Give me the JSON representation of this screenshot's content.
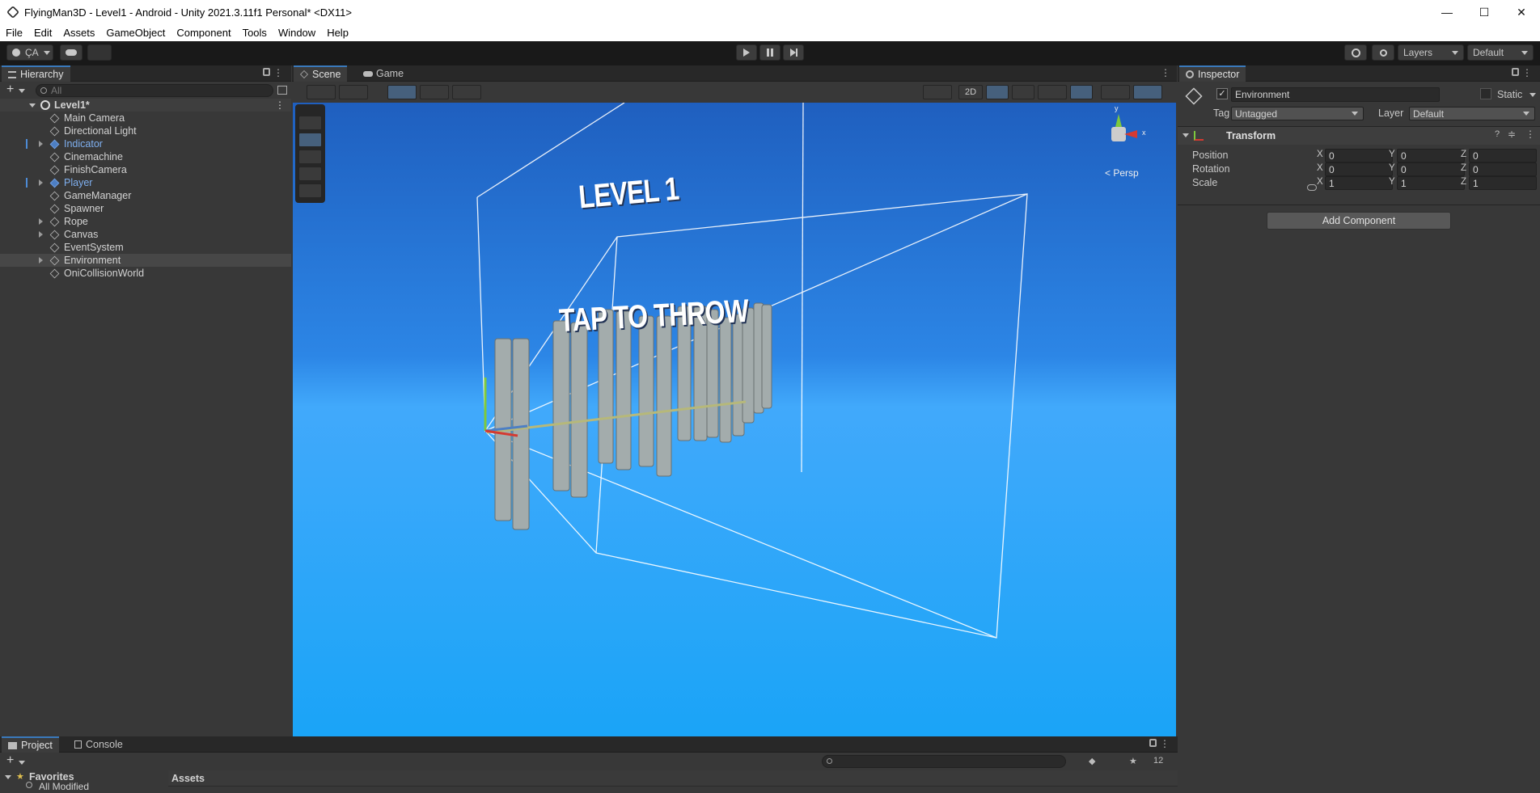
{
  "window": {
    "title": "FlyingMan3D - Level1 - Android - Unity 2021.3.11f1 Personal* <DX11>",
    "controls": {
      "minimize": "—",
      "maximize": "☐",
      "close": "✕"
    }
  },
  "menu": [
    "File",
    "Edit",
    "Assets",
    "GameObject",
    "Component",
    "Tools",
    "Window",
    "Help"
  ],
  "toolbar": {
    "account_label": "ÇA",
    "layers_label": "Layers",
    "layout_label": "Default"
  },
  "hierarchy": {
    "tab_label": "Hierarchy",
    "search_placeholder": "All",
    "scene_name": "Level1*",
    "items": [
      {
        "label": "Main Camera",
        "prefab": false,
        "expandable": false
      },
      {
        "label": "Directional Light",
        "prefab": false,
        "expandable": false
      },
      {
        "label": "Indicator",
        "prefab": true,
        "expandable": true
      },
      {
        "label": "Cinemachine",
        "prefab": false,
        "expandable": false
      },
      {
        "label": "FinishCamera",
        "prefab": false,
        "expandable": false
      },
      {
        "label": "Player",
        "prefab": true,
        "expandable": true
      },
      {
        "label": "GameManager",
        "prefab": false,
        "expandable": false
      },
      {
        "label": "Spawner",
        "prefab": false,
        "expandable": false
      },
      {
        "label": "Rope",
        "prefab": false,
        "expandable": true
      },
      {
        "label": "Canvas",
        "prefab": false,
        "expandable": true
      },
      {
        "label": "EventSystem",
        "prefab": false,
        "expandable": false
      },
      {
        "label": "Environment",
        "prefab": false,
        "expandable": true,
        "selected": true
      },
      {
        "label": "OniCollisionWorld",
        "prefab": false,
        "expandable": false
      }
    ]
  },
  "scene": {
    "tabs": [
      "Scene",
      "Game"
    ],
    "toggle_2d": "2D",
    "persp_label": "Persp",
    "gizmo_axes": {
      "y": "y",
      "x": "x"
    },
    "canvas_texts": [
      "LEVEL 1",
      "TAP TO THROW"
    ]
  },
  "inspector": {
    "tab_label": "Inspector",
    "object_name": "Environment",
    "static_label": "Static",
    "tag_label": "Tag",
    "tag_value": "Untagged",
    "layer_label": "Layer",
    "layer_value": "Default",
    "component_name": "Transform",
    "rows": [
      {
        "label": "Position",
        "x": "0",
        "y": "0",
        "z": "0"
      },
      {
        "label": "Rotation",
        "x": "0",
        "y": "0",
        "z": "0"
      },
      {
        "label": "Scale",
        "x": "1",
        "y": "1",
        "z": "1"
      }
    ],
    "axis_labels": [
      "X",
      "Y",
      "Z"
    ],
    "add_component_label": "Add Component"
  },
  "project": {
    "tabs": [
      "Project",
      "Console"
    ],
    "favorites_label": "Favorites",
    "favorites_item": "All Modified",
    "assets_label": "Assets",
    "hidden_count": "12"
  }
}
